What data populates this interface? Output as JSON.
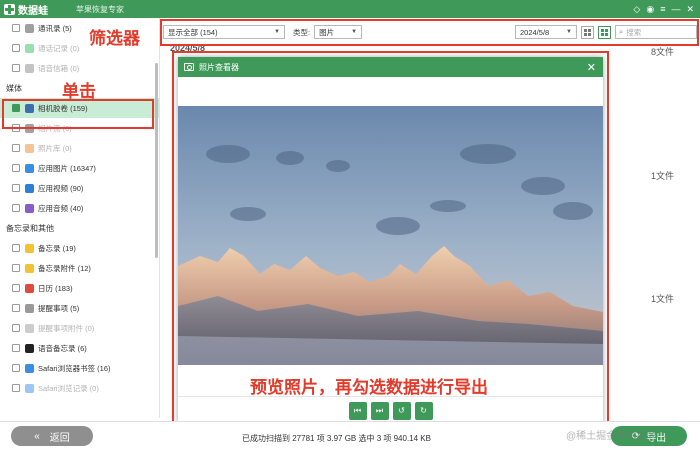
{
  "app": {
    "name": "数据蛙",
    "subtitle": "苹果恢复专家"
  },
  "titlebar_icons": [
    "diamond-icon",
    "chat-icon",
    "menu-icon",
    "minimize-icon",
    "close-icon"
  ],
  "sidebar": {
    "top_items": [
      {
        "label": "通讯录 (5)",
        "icon": "contacts-icon",
        "color": "#a0a0a0",
        "dim": false
      },
      {
        "label": "通话记录 (0)",
        "icon": "phone-icon",
        "color": "#2fbf5a",
        "dim": true
      },
      {
        "label": "语音信箱 (0)",
        "icon": "voicemail-icon",
        "color": "#888888",
        "dim": true
      }
    ],
    "media_group": "媒体",
    "media_items": [
      {
        "label": "相机胶卷 (159)",
        "icon": "camera-roll-icon",
        "color": "#3d6fb0",
        "dim": false,
        "active": true
      },
      {
        "label": "相片流 (0)",
        "icon": "photo-stream-icon",
        "color": "#444444",
        "dim": true
      },
      {
        "label": "照片库 (0)",
        "icon": "photo-library-icon",
        "color": "#e88a2c",
        "dim": true
      },
      {
        "label": "应用图片 (16347)",
        "icon": "app-photos-icon",
        "color": "#3a8ee0",
        "dim": false
      },
      {
        "label": "应用视频 (90)",
        "icon": "app-video-icon",
        "color": "#2b7fd4",
        "dim": false
      },
      {
        "label": "应用音频 (40)",
        "icon": "app-audio-icon",
        "color": "#8a5cc9",
        "dim": false
      }
    ],
    "memo_group": "备忘录和其他",
    "memo_items": [
      {
        "label": "备忘录 (19)",
        "icon": "notes-icon",
        "color": "#f2c230",
        "dim": false
      },
      {
        "label": "备忘录附件 (12)",
        "icon": "notes-attachment-icon",
        "color": "#f2c230",
        "dim": false
      },
      {
        "label": "日历 (183)",
        "icon": "calendar-icon",
        "color": "#e04a3a",
        "dim": false
      },
      {
        "label": "提醒事项 (5)",
        "icon": "reminders-icon",
        "color": "#999999",
        "dim": false
      },
      {
        "label": "提醒事项附件 (0)",
        "icon": "reminders-attachment-icon",
        "color": "#999999",
        "dim": true
      },
      {
        "label": "语音备忘录 (6)",
        "icon": "voice-memo-icon",
        "color": "#222222",
        "dim": false
      },
      {
        "label": "Safari浏览器书签 (16)",
        "icon": "safari-bookmark-icon",
        "color": "#3a8ee0",
        "dim": false
      },
      {
        "label": "Safari浏览记录 (0)",
        "icon": "safari-history-icon",
        "color": "#3a8ee0",
        "dim": true
      }
    ]
  },
  "filter": {
    "show_value": "显示全部 (154)",
    "type_label": "类型:",
    "type_value": "图片",
    "date_value": "2024/5/8",
    "search_placeholder": "搜索"
  },
  "content": {
    "date_header": "2024/5/8",
    "counts": [
      "8文件",
      "1文件",
      "1文件"
    ]
  },
  "viewer": {
    "title": "照片查看器",
    "close": "✕",
    "controls": [
      "prev-icon",
      "next-icon",
      "rotate-left-icon",
      "rotate-right-icon"
    ]
  },
  "annotations": {
    "filter": "筛选器",
    "click": "单击",
    "preview": "预览照片，再勾选数据进行导出"
  },
  "bottom": {
    "back_label": "返回",
    "status": "已成功扫描到 27781 项 3.97 GB  选中 3 项 940.14 KB",
    "export_label": "导出",
    "watermark": "@稀土掘金技术社区"
  },
  "colors": {
    "brand_green": "#3f9a5a",
    "annotation_red": "#e33b2b",
    "active_row": "#c9ecd6"
  }
}
